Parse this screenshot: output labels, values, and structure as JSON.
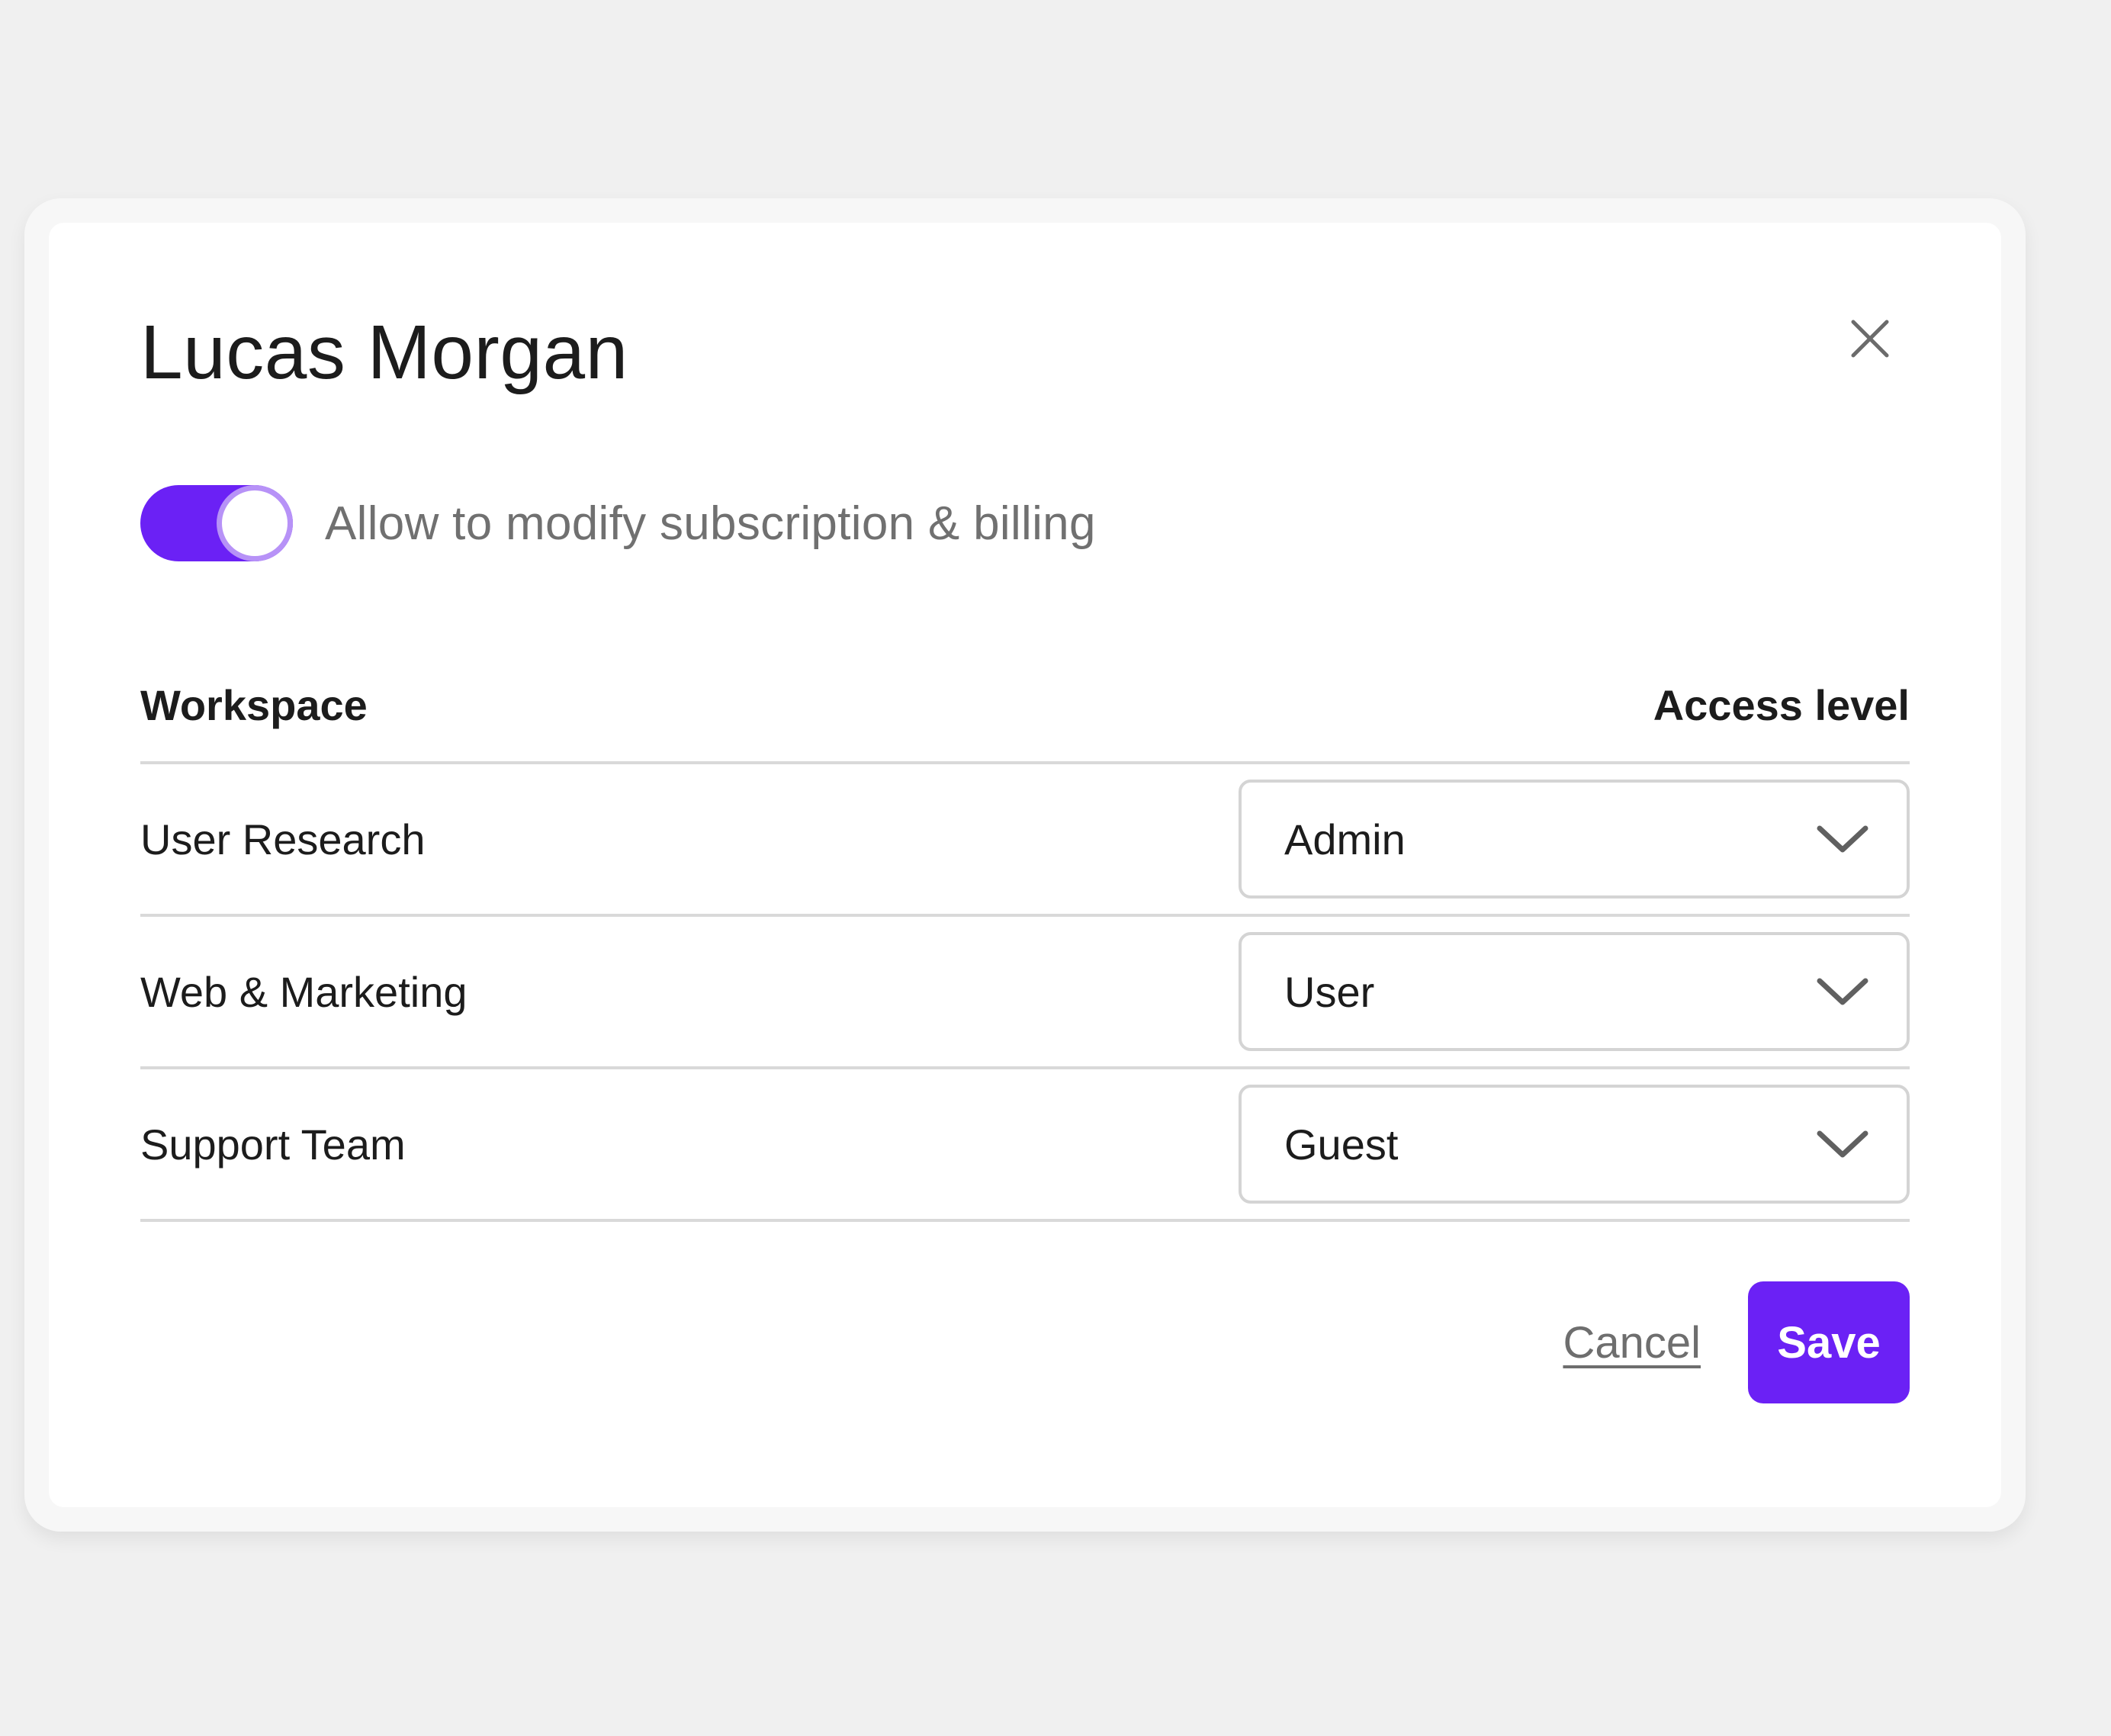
{
  "modal": {
    "title": "Lucas Morgan",
    "close_icon": "close-icon"
  },
  "permission_toggle": {
    "label": "Allow to modify subscription & billing",
    "enabled": true,
    "accent_color": "#6b21f5"
  },
  "table": {
    "headers": {
      "workspace": "Workspace",
      "access_level": "Access level"
    },
    "rows": [
      {
        "workspace": "User Research",
        "access_level": "Admin"
      },
      {
        "workspace": "Web & Marketing",
        "access_level": "User"
      },
      {
        "workspace": "Support Team",
        "access_level": "Guest"
      }
    ],
    "dropdown_icon": "chevron-down-icon"
  },
  "footer": {
    "cancel_label": "Cancel",
    "save_label": "Save"
  }
}
